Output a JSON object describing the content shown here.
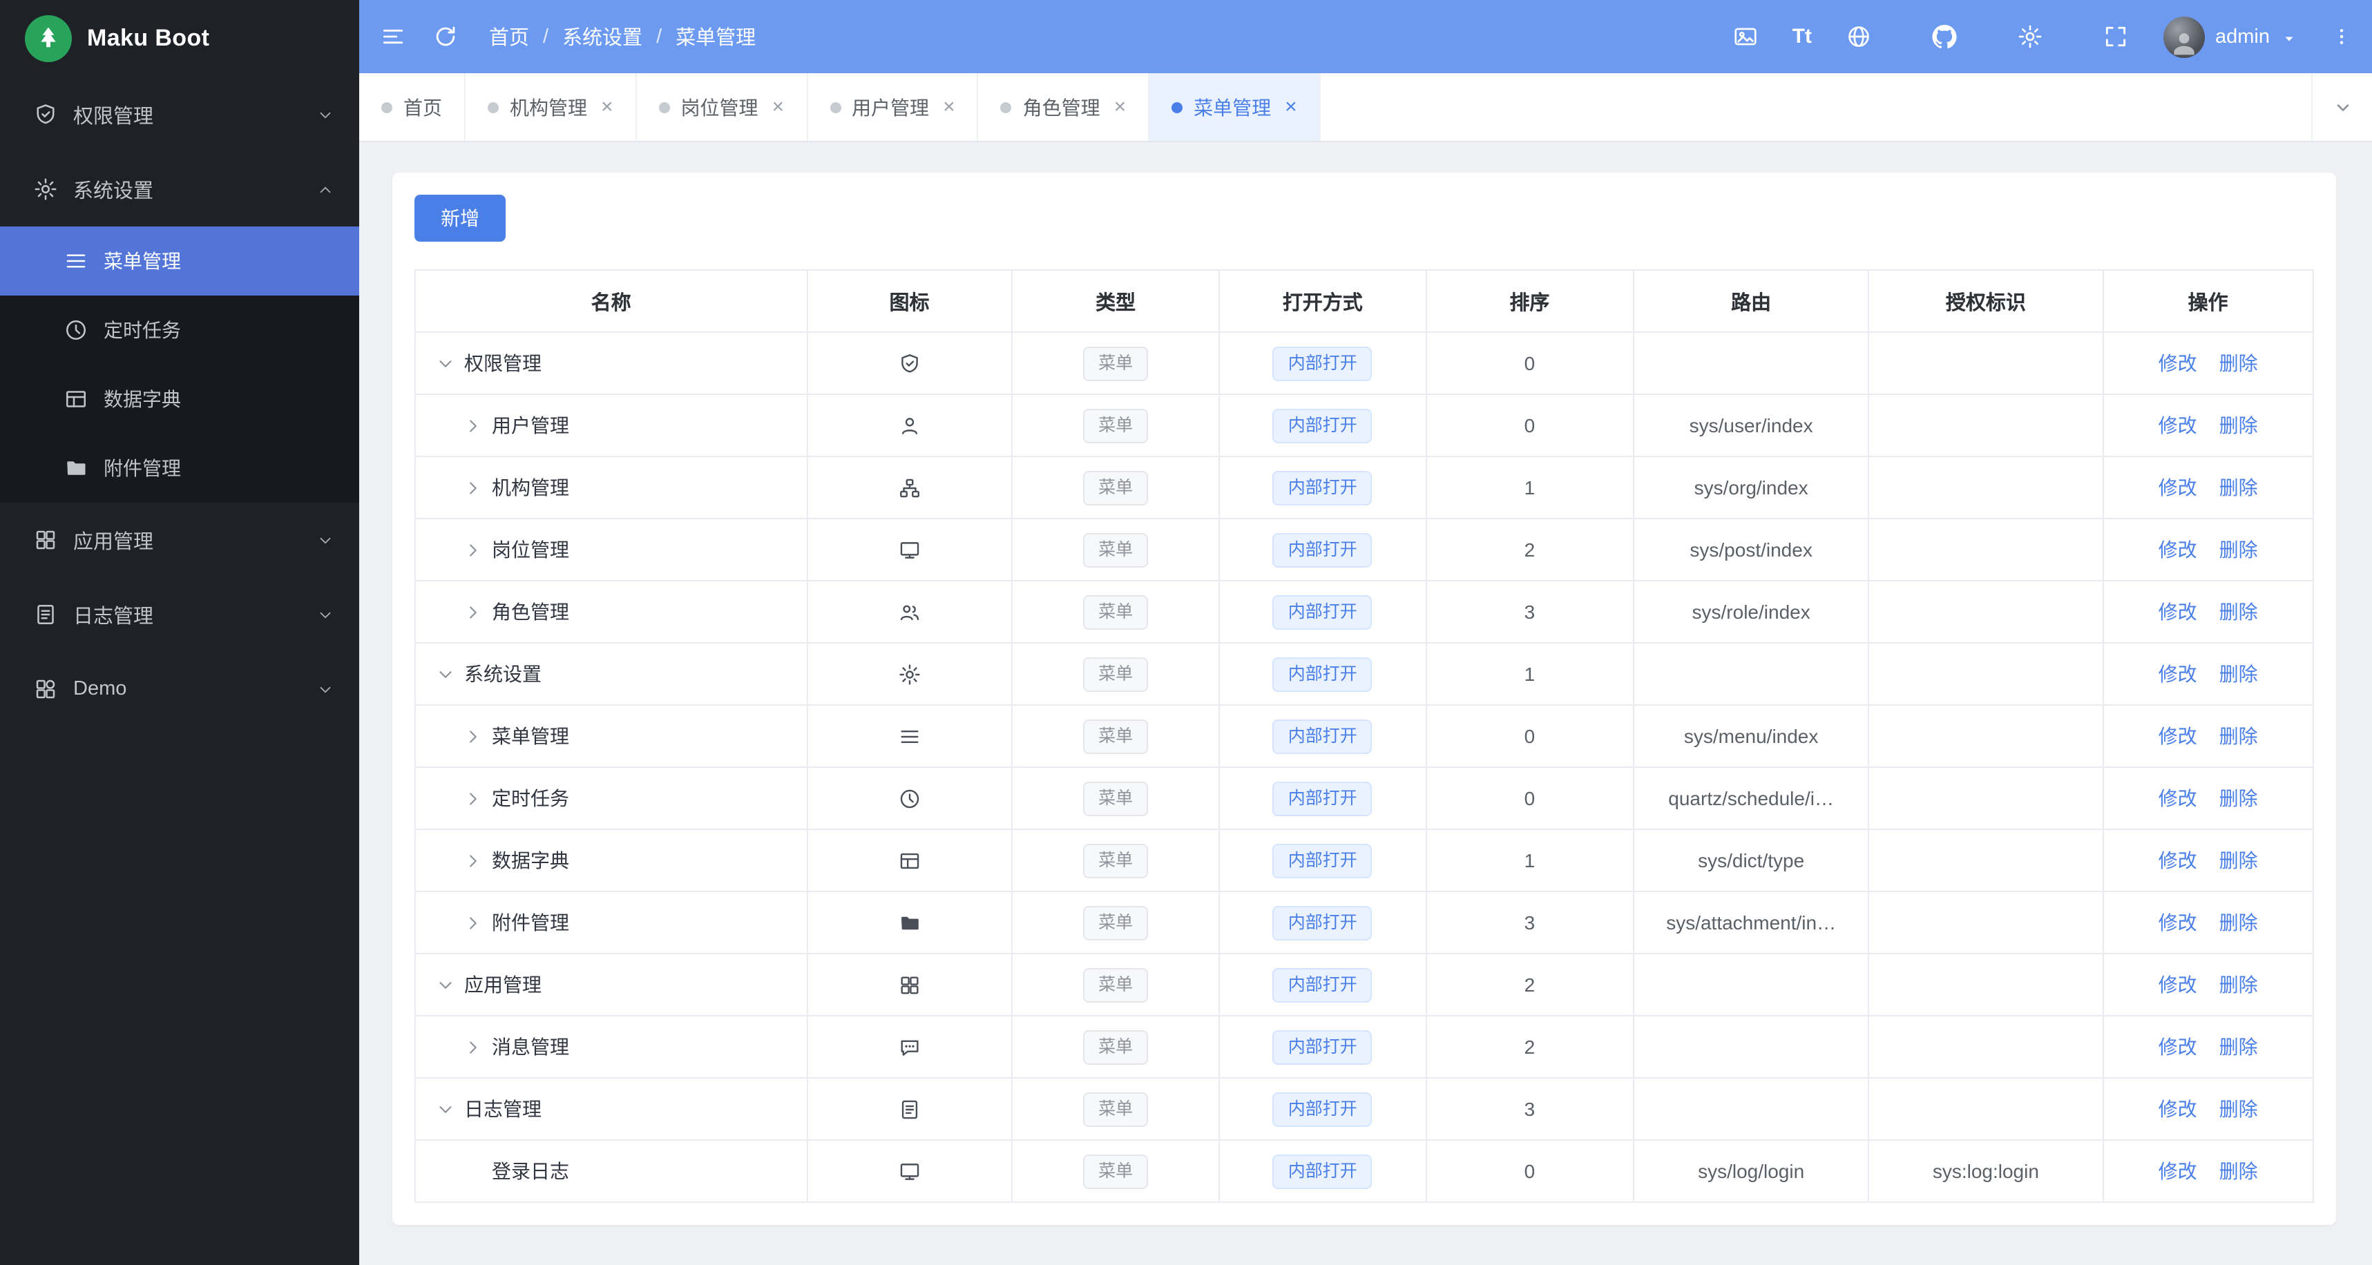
{
  "app": {
    "title": "Maku Boot"
  },
  "colors": {
    "header_bg": "#6d9af1",
    "sidebar_bg": "#1e2126",
    "sidebar_active_bg": "#5375d8",
    "primary": "#4a7fe8",
    "logo_green": "#27a35a"
  },
  "header": {
    "breadcrumb": [
      "首页",
      "系统设置",
      "菜单管理"
    ],
    "breadcrumb_separator": "/",
    "font_icon_label": "Tt",
    "username": "admin"
  },
  "sidebar": {
    "menu": [
      {
        "label": "权限管理",
        "icon": "shield",
        "state": "collapsed"
      },
      {
        "label": "系统设置",
        "icon": "gear",
        "state": "expanded",
        "children": [
          {
            "label": "菜单管理",
            "icon": "menu",
            "active": true
          },
          {
            "label": "定时任务",
            "icon": "clock",
            "active": false
          },
          {
            "label": "数据字典",
            "icon": "table",
            "active": false
          },
          {
            "label": "附件管理",
            "icon": "folder",
            "active": false
          }
        ]
      },
      {
        "label": "应用管理",
        "icon": "grid",
        "state": "collapsed"
      },
      {
        "label": "日志管理",
        "icon": "doc",
        "state": "collapsed"
      },
      {
        "label": "Demo",
        "icon": "demo",
        "state": "collapsed"
      }
    ]
  },
  "tabs": {
    "close_glyph": "×",
    "items": [
      {
        "label": "首页",
        "closable": false,
        "active": false
      },
      {
        "label": "机构管理",
        "closable": true,
        "active": false
      },
      {
        "label": "岗位管理",
        "closable": true,
        "active": false
      },
      {
        "label": "用户管理",
        "closable": true,
        "active": false
      },
      {
        "label": "角色管理",
        "closable": true,
        "active": false
      },
      {
        "label": "菜单管理",
        "closable": true,
        "active": true
      }
    ]
  },
  "toolbar": {
    "add_label": "新增"
  },
  "table": {
    "headers": [
      "名称",
      "图标",
      "类型",
      "打开方式",
      "排序",
      "路由",
      "授权标识",
      "操作"
    ],
    "edit_label": "修改",
    "delete_label": "删除",
    "rows": [
      {
        "name": "权限管理",
        "level": 0,
        "expand": "down",
        "icon": "shield",
        "type": "菜单",
        "open": "内部打开",
        "sort": "0",
        "route": "",
        "auth": ""
      },
      {
        "name": "用户管理",
        "level": 1,
        "expand": "right",
        "icon": "user",
        "type": "菜单",
        "open": "内部打开",
        "sort": "0",
        "route": "sys/user/index",
        "auth": ""
      },
      {
        "name": "机构管理",
        "level": 1,
        "expand": "right",
        "icon": "org",
        "type": "菜单",
        "open": "内部打开",
        "sort": "1",
        "route": "sys/org/index",
        "auth": ""
      },
      {
        "name": "岗位管理",
        "level": 1,
        "expand": "right",
        "icon": "monitor",
        "type": "菜单",
        "open": "内部打开",
        "sort": "2",
        "route": "sys/post/index",
        "auth": ""
      },
      {
        "name": "角色管理",
        "level": 1,
        "expand": "right",
        "icon": "role",
        "type": "菜单",
        "open": "内部打开",
        "sort": "3",
        "route": "sys/role/index",
        "auth": ""
      },
      {
        "name": "系统设置",
        "level": 0,
        "expand": "down",
        "icon": "gear",
        "type": "菜单",
        "open": "内部打开",
        "sort": "1",
        "route": "",
        "auth": ""
      },
      {
        "name": "菜单管理",
        "level": 1,
        "expand": "right",
        "icon": "menu",
        "type": "菜单",
        "open": "内部打开",
        "sort": "0",
        "route": "sys/menu/index",
        "auth": ""
      },
      {
        "name": "定时任务",
        "level": 1,
        "expand": "right",
        "icon": "clock",
        "type": "菜单",
        "open": "内部打开",
        "sort": "0",
        "route": "quartz/schedule/i…",
        "auth": ""
      },
      {
        "name": "数据字典",
        "level": 1,
        "expand": "right",
        "icon": "table",
        "type": "菜单",
        "open": "内部打开",
        "sort": "1",
        "route": "sys/dict/type",
        "auth": ""
      },
      {
        "name": "附件管理",
        "level": 1,
        "expand": "right",
        "icon": "folder",
        "type": "菜单",
        "open": "内部打开",
        "sort": "3",
        "route": "sys/attachment/in…",
        "auth": ""
      },
      {
        "name": "应用管理",
        "level": 0,
        "expand": "down",
        "icon": "grid",
        "type": "菜单",
        "open": "内部打开",
        "sort": "2",
        "route": "",
        "auth": ""
      },
      {
        "name": "消息管理",
        "level": 1,
        "expand": "right",
        "icon": "message",
        "type": "菜单",
        "open": "内部打开",
        "sort": "2",
        "route": "",
        "auth": ""
      },
      {
        "name": "日志管理",
        "level": 0,
        "expand": "down",
        "icon": "doc",
        "type": "菜单",
        "open": "内部打开",
        "sort": "3",
        "route": "",
        "auth": ""
      },
      {
        "name": "登录日志",
        "level": 1,
        "expand": "none",
        "icon": "monitor",
        "type": "菜单",
        "open": "内部打开",
        "sort": "0",
        "route": "sys/log/login",
        "auth": "sys:log:login"
      }
    ]
  }
}
